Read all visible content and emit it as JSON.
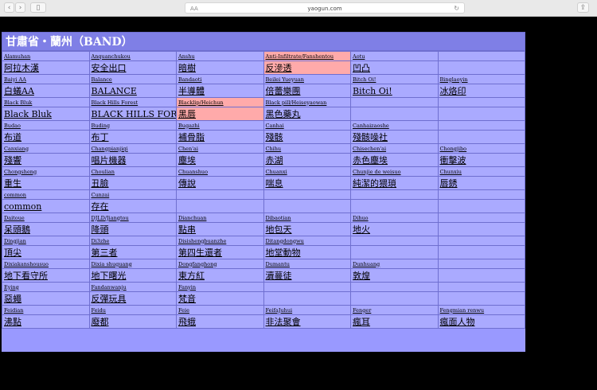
{
  "browser": {
    "url": "yaogun.com",
    "reader_icon": "AA",
    "reload_icon": "reload-icon",
    "back_icon": "chevron-left-icon",
    "forward_icon": "chevron-right-icon",
    "sidebar_icon": "sidebar-icon",
    "share_icon": "share-icon"
  },
  "page": {
    "title": "甘肅省・蘭州（BAND）"
  },
  "colors": {
    "cell_bg": "#aaaaff",
    "highlight_bg": "#ffaaaa",
    "title_bg": "#7f7fe6"
  },
  "rows": [
    {
      "romanization": [
        "Alamuhan",
        "Anquanchukou",
        "Anshu",
        "Anti-Infiltrate/Fanshentou",
        "Aotu",
        ""
      ],
      "chinese": [
        "阿拉木漢",
        "安全出口",
        "暗樹",
        "反滲透",
        "凹凸",
        ""
      ],
      "highlight": [
        false,
        false,
        false,
        true,
        false,
        false
      ]
    },
    {
      "romanization": [
        "Baiyi AA",
        "Balance",
        "Bandaoti",
        "Beilei Yueyuan",
        "Bitch Oi!",
        "Binglaoyin"
      ],
      "chinese": [
        "白蟻AA",
        "BALANCE",
        "半導體",
        "倍蕾樂團",
        "Bitch Oi!",
        "冰烙印"
      ],
      "highlight": [
        false,
        false,
        false,
        false,
        false,
        false
      ]
    },
    {
      "romanization": [
        "Black Bluk",
        "Black Hills Forest",
        "Blacklip/Heichun",
        "Black pill/Heiseyaowan",
        "",
        ""
      ],
      "chinese": [
        "Black Bluk",
        "BLACK HILLS FOREST",
        "黑唇",
        "黑色藥丸",
        "",
        ""
      ],
      "highlight": [
        false,
        false,
        true,
        false,
        false,
        false
      ]
    },
    {
      "romanization": [
        "Budao",
        "Buding",
        "Bugazhi",
        "Canhai",
        "Canhaizaoshe",
        ""
      ],
      "chinese": [
        "布道",
        "布丁",
        "補骨脂",
        "殘骸",
        "殘骸噪社",
        ""
      ],
      "highlight": [
        false,
        false,
        false,
        false,
        false,
        false
      ]
    },
    {
      "romanization": [
        "Canxiang",
        "Changpianjiqi",
        "Chen'ai",
        "Chihu",
        "Chisechen'ai",
        "Chongjibo"
      ],
      "chinese": [
        "殘響",
        "唱片機器",
        "塵埃",
        "赤湖",
        "赤色塵埃",
        "衝擊波"
      ],
      "highlight": [
        false,
        false,
        false,
        false,
        false,
        false
      ]
    },
    {
      "romanization": [
        "Chongsheng",
        "Choulian",
        "Chuanshuo",
        "Chuanxi",
        "Chunjie de weisuo",
        "Chunxiu"
      ],
      "chinese": [
        "重生",
        "丑臉",
        "傳說",
        "喘息",
        "純潔的猥瑣",
        "唇銹"
      ],
      "highlight": [
        false,
        false,
        false,
        false,
        false,
        false
      ]
    },
    {
      "romanization": [
        "common",
        "Cunzai",
        "",
        "",
        "",
        ""
      ],
      "chinese": [
        "common",
        "存在",
        "",
        "",
        "",
        ""
      ],
      "highlight": [
        false,
        false,
        false,
        false,
        false,
        false
      ]
    },
    {
      "romanization": [
        "Daitoue",
        "DJLD/Jiangtou",
        "Dianchuan",
        "Dibaotian",
        "Dihuo",
        ""
      ],
      "chinese": [
        "呆頭鵝",
        "降頭",
        "點串",
        "地包天",
        "地火",
        ""
      ],
      "highlight": [
        false,
        false,
        false,
        false,
        false,
        false
      ]
    },
    {
      "romanization": [
        "Dingjian",
        "Di3zhe",
        "Disishengbuanzhe",
        "Ditangdongwu",
        "",
        ""
      ],
      "chinese": [
        "頂尖",
        "第三者",
        "第四生還者",
        "地堂動物",
        "",
        ""
      ],
      "highlight": [
        false,
        false,
        false,
        false,
        false,
        false
      ]
    },
    {
      "romanization": [
        "Dixiakanshousuo",
        "Dixia shuguang",
        "Dongfanghong",
        "Dumantu",
        "Dunhuang",
        ""
      ],
      "chinese": [
        "地下看守所",
        "地下曙光",
        "東方紅",
        "瀆蔓徒",
        "敦煌",
        ""
      ],
      "highlight": [
        false,
        false,
        false,
        false,
        false,
        false
      ]
    },
    {
      "romanization": [
        "Eying",
        "Fandanwanju",
        "Fanyin",
        "",
        "",
        ""
      ],
      "chinese": [
        "惡蠅",
        "反彈玩具",
        "梵音",
        "",
        "",
        ""
      ],
      "highlight": [
        false,
        false,
        false,
        false,
        false,
        false
      ]
    },
    {
      "romanization": [
        "Feidian",
        "Feidu",
        "Feie",
        "FeifaJuhui",
        "Fenger",
        "Fengmian renwu"
      ],
      "chinese": [
        "沸點",
        "廢都",
        "飛蛾",
        "非法聚會",
        "瘋耳",
        "瘋面人物"
      ],
      "highlight": [
        false,
        false,
        false,
        false,
        false,
        false
      ]
    }
  ]
}
